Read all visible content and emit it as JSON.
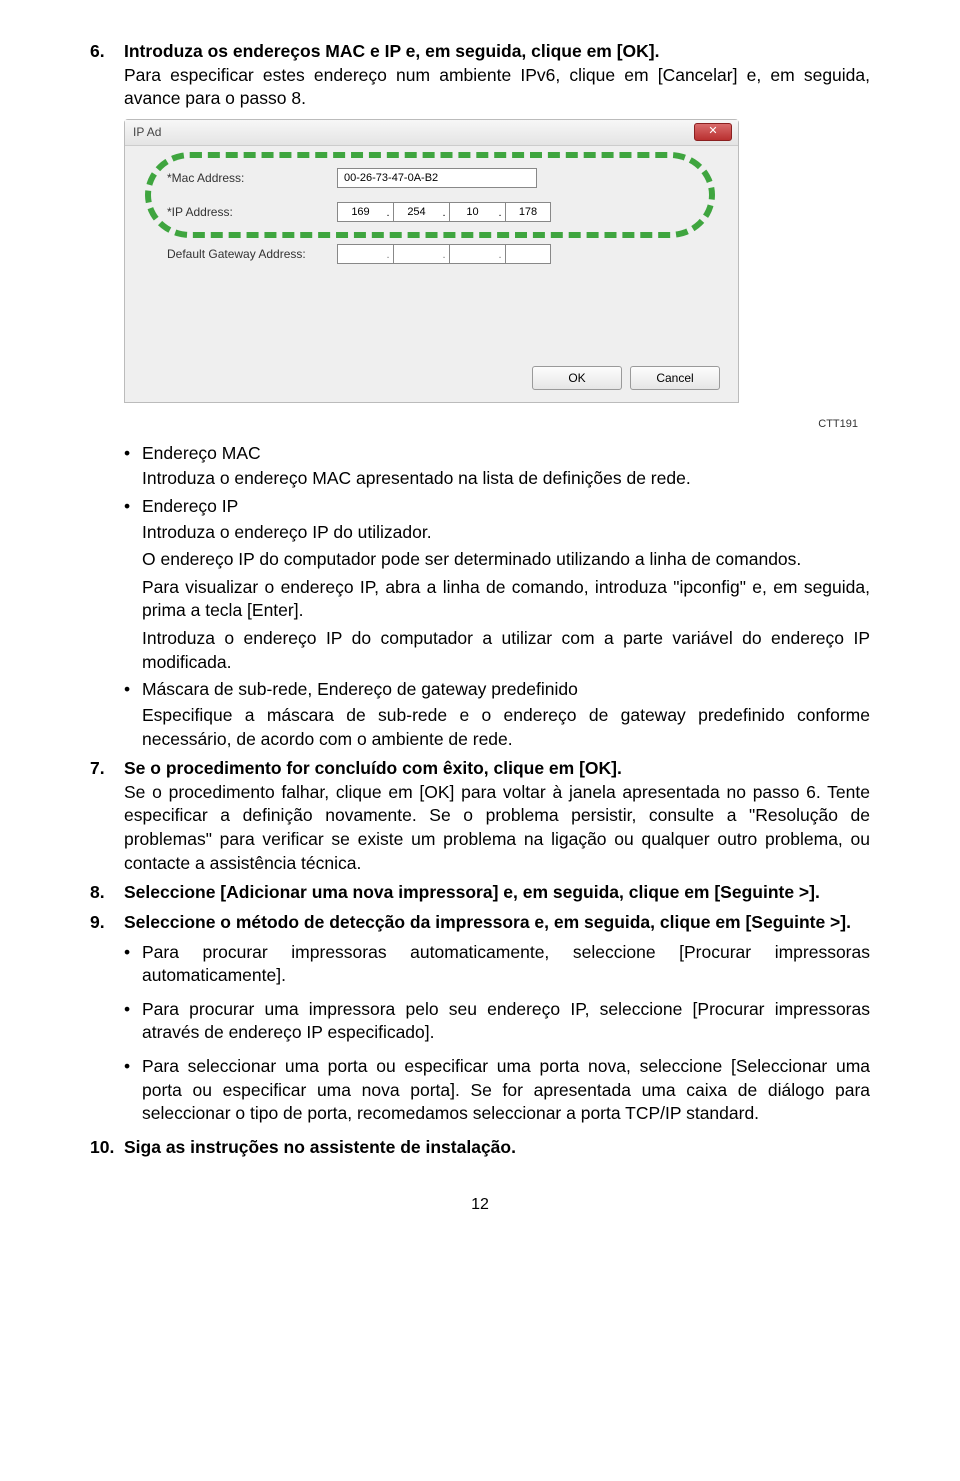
{
  "step6": {
    "num": "6.",
    "title": "Introduza os endereços MAC e IP e, em seguida, clique em [OK].",
    "note": "Para especificar estes endereço num ambiente IPv6, clique em [Cancelar] e, em seguida, avance para o passo 8."
  },
  "dialog": {
    "title_prefix": "IP Ad",
    "close_glyph": "✕",
    "mac_label": "*Mac Address:",
    "mac_value": "00-26-73-47-0A-B2",
    "ip_label": "*IP Address:",
    "ip_values": [
      "169",
      "254",
      "10",
      "178"
    ],
    "gw_label": "Default Gateway Address:",
    "gw_values": [
      "",
      "",
      "",
      ""
    ],
    "ok": "OK",
    "cancel": "Cancel"
  },
  "img_ref": "CTT191",
  "b1": {
    "label": "Endereço MAC",
    "line": "Introduza o endereço MAC apresentado na lista de definições de rede."
  },
  "b2": {
    "label": "Endereço IP",
    "l1": "Introduza o endereço IP do utilizador.",
    "l2": "O endereço IP do computador pode ser determinado utilizando a linha de comandos.",
    "l3": "Para visualizar o endereço IP, abra a linha de comando, introduza \"ipconfig\" e, em seguida, prima a tecla [Enter].",
    "l4": "Introduza o endereço IP do computador a utilizar com a parte variável do endereço IP modificada."
  },
  "b3": {
    "label": "Máscara de sub-rede, Endereço de gateway predefinido",
    "line": "Especifique a máscara de sub-rede e o endereço de gateway predefinido conforme necessário, de acordo com o ambiente de rede."
  },
  "step7": {
    "num": "7.",
    "title": "Se o procedimento for concluído com êxito, clique em [OK].",
    "body": "Se o procedimento falhar, clique em [OK] para voltar à janela apresentada no passo 6. Tente especificar a definição novamente. Se o problema persistir, consulte a \"Resolução de problemas\" para verificar se existe um problema na ligação ou qualquer outro problema, ou contacte a assistência técnica."
  },
  "step8": {
    "num": "8.",
    "title": "Seleccione [Adicionar uma nova impressora] e, em seguida, clique em [Seguinte >]."
  },
  "step9": {
    "num": "9.",
    "title": "Seleccione o método de detecção da impressora e, em seguida, clique em [Seguinte >].",
    "b1": "Para procurar impressoras automaticamente, seleccione [Procurar impressoras automaticamente].",
    "b2": "Para procurar uma impressora pelo seu endereço IP, seleccione [Procurar impressoras através de endereço IP especificado].",
    "b3": "Para seleccionar uma porta ou especificar uma porta nova, seleccione [Seleccionar uma porta ou especificar uma nova porta]. Se for apresentada uma caixa de diálogo para seleccionar o tipo de porta, recomedamos seleccionar a porta TCP/IP standard."
  },
  "step10": {
    "num": "10.",
    "title": "Siga as instruções no assistente de instalação."
  },
  "pagenum": "12"
}
